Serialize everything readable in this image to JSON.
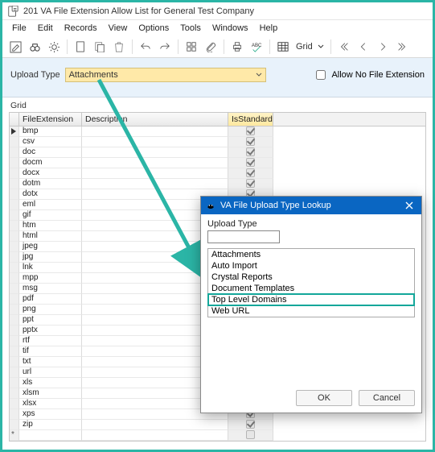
{
  "window": {
    "title": "201 VA File Extension Allow List for General Test Company"
  },
  "menu": {
    "items": [
      "File",
      "Edit",
      "Records",
      "View",
      "Options",
      "Tools",
      "Windows",
      "Help"
    ]
  },
  "toolbar": {
    "grid_label": "Grid"
  },
  "form": {
    "upload_type_label": "Upload Type",
    "upload_type_value": "Attachments",
    "allow_no_ext_label": "Allow No File Extension",
    "allow_no_ext_checked": false
  },
  "grid": {
    "label": "Grid",
    "columns": [
      "FileExtension",
      "Description",
      "IsStandard"
    ],
    "rows": [
      {
        "ext": "bmp",
        "desc": "",
        "std": true,
        "current": true
      },
      {
        "ext": "csv",
        "desc": "",
        "std": true
      },
      {
        "ext": "doc",
        "desc": "",
        "std": true
      },
      {
        "ext": "docm",
        "desc": "",
        "std": true
      },
      {
        "ext": "docx",
        "desc": "",
        "std": true
      },
      {
        "ext": "dotm",
        "desc": "",
        "std": true
      },
      {
        "ext": "dotx",
        "desc": "",
        "std": true
      },
      {
        "ext": "eml",
        "desc": "",
        "std": true
      },
      {
        "ext": "gif",
        "desc": "",
        "std": true
      },
      {
        "ext": "htm",
        "desc": "",
        "std": true
      },
      {
        "ext": "html",
        "desc": "",
        "std": true
      },
      {
        "ext": "jpeg",
        "desc": "",
        "std": true
      },
      {
        "ext": "jpg",
        "desc": "",
        "std": true
      },
      {
        "ext": "lnk",
        "desc": "",
        "std": true
      },
      {
        "ext": "mpp",
        "desc": "",
        "std": true
      },
      {
        "ext": "msg",
        "desc": "",
        "std": true
      },
      {
        "ext": "pdf",
        "desc": "",
        "std": true
      },
      {
        "ext": "png",
        "desc": "",
        "std": true
      },
      {
        "ext": "ppt",
        "desc": "",
        "std": true
      },
      {
        "ext": "pptx",
        "desc": "",
        "std": true
      },
      {
        "ext": "rtf",
        "desc": "",
        "std": true
      },
      {
        "ext": "tif",
        "desc": "",
        "std": true
      },
      {
        "ext": "txt",
        "desc": "",
        "std": true
      },
      {
        "ext": "url",
        "desc": "",
        "std": true
      },
      {
        "ext": "xls",
        "desc": "",
        "std": true
      },
      {
        "ext": "xlsm",
        "desc": "",
        "std": true
      },
      {
        "ext": "xlsx",
        "desc": "",
        "std": true
      },
      {
        "ext": "xps",
        "desc": "",
        "std": true
      },
      {
        "ext": "zip",
        "desc": "",
        "std": true
      }
    ]
  },
  "dialog": {
    "title": "VA File Upload Type Lookup",
    "field_label": "Upload Type",
    "field_value": "",
    "options": [
      "Attachments",
      "Auto Import",
      "Crystal Reports",
      "Document Templates",
      "Top Level Domains",
      "Web URL"
    ],
    "highlight_index": 4,
    "ok_label": "OK",
    "cancel_label": "Cancel"
  },
  "colors": {
    "accent_teal": "#2bb5a6",
    "dialog_blue": "#0a66c2",
    "field_highlight": "#ffe9a8"
  }
}
